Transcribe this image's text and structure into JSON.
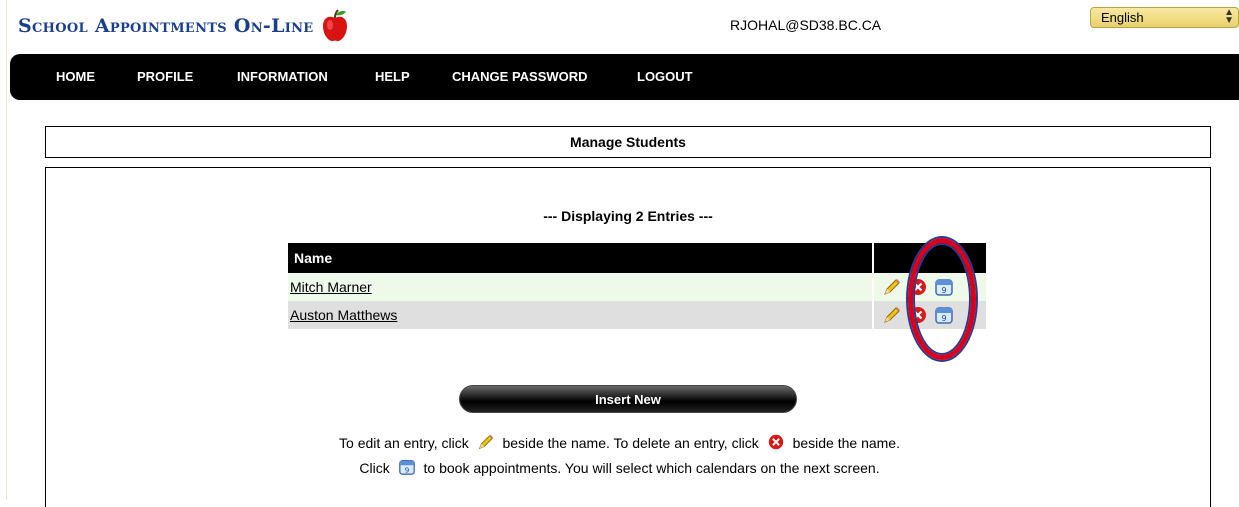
{
  "header": {
    "logo_text": "School Appointments On-Line",
    "user_email": "RJOHAL@SD38.BC.CA",
    "language": "English"
  },
  "nav": [
    "HOME",
    "PROFILE",
    "INFORMATION",
    "HELP",
    "CHANGE PASSWORD",
    "LOGOUT"
  ],
  "page": {
    "title": "Manage Students",
    "entries_label": "--- Displaying 2 Entries ---"
  },
  "table": {
    "name_header": "Name",
    "rows": [
      "Mitch Marner",
      "Auston Matthews"
    ]
  },
  "insert_label": "Insert New",
  "help": {
    "line1_a": "To edit an entry, click",
    "line1_b": "beside the name. To delete an entry, click",
    "line1_c": "beside the name.",
    "line2_a": "Click",
    "line2_b": "to book appointments. You will select which calendars on the next screen."
  },
  "colors": {
    "logo": "#1b3f8f",
    "highlight": "#d8001a",
    "row_alt_1": "#eef9ea",
    "row_alt_2": "#dfdfdf"
  },
  "icons": [
    "apple-logo-icon",
    "pencil-edit-icon",
    "delete-icon",
    "calendar-icon"
  ]
}
